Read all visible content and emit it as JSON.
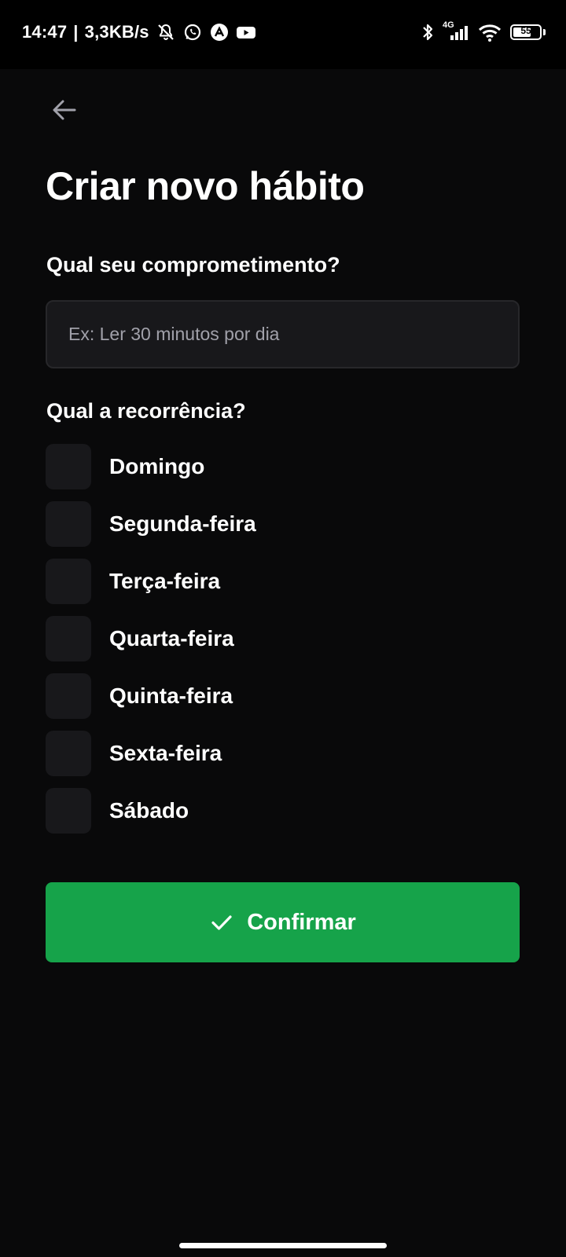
{
  "status_bar": {
    "time": "14:47",
    "net_speed": "3,3KB/s",
    "network_type": "4G",
    "battery_level": "55",
    "icons": [
      "bell-muted-icon",
      "whatsapp-icon",
      "app-a-icon",
      "youtube-icon",
      "bluetooth-icon",
      "signal-icon",
      "wifi-icon",
      "battery-icon"
    ]
  },
  "header": {
    "back_icon": "arrow-left-icon",
    "title": "Criar novo hábito"
  },
  "form": {
    "commitment_label": "Qual seu comprometimento?",
    "commitment_value": "",
    "commitment_placeholder": "Ex: Ler 30 minutos por dia",
    "recurrence_label": "Qual a recorrência?",
    "weekdays": [
      {
        "label": "Domingo",
        "checked": false
      },
      {
        "label": "Segunda-feira",
        "checked": false
      },
      {
        "label": "Terça-feira",
        "checked": false
      },
      {
        "label": "Quarta-feira",
        "checked": false
      },
      {
        "label": "Quinta-feira",
        "checked": false
      },
      {
        "label": "Sexta-feira",
        "checked": false
      },
      {
        "label": "Sábado",
        "checked": false
      }
    ],
    "confirm_label": "Confirmar",
    "confirm_icon": "check-icon"
  },
  "colors": {
    "background": "#09090a",
    "surface": "#18181b",
    "border": "#27272a",
    "accent": "#16a34a",
    "placeholder": "#a1a1aa",
    "back_icon": "#a1a1aa"
  }
}
